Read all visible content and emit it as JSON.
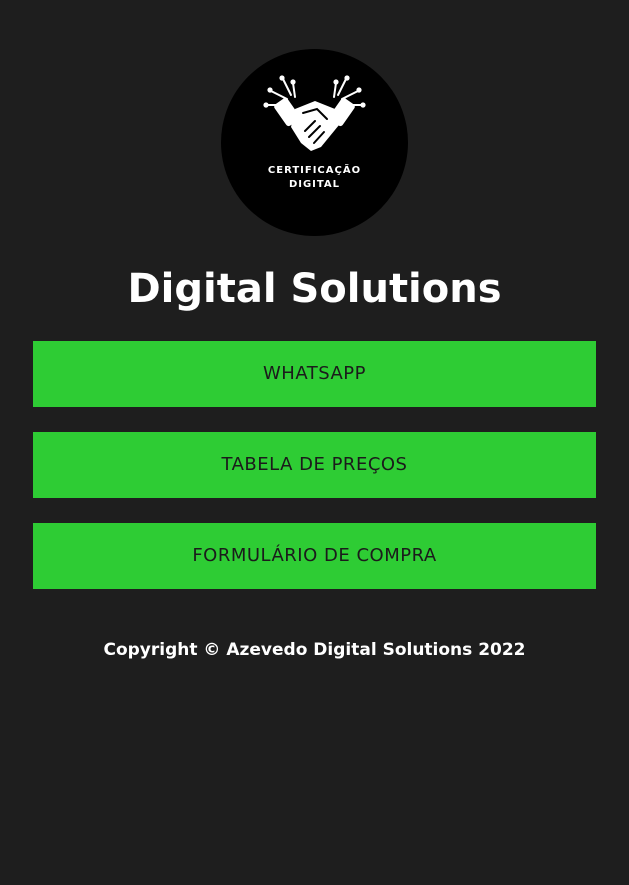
{
  "logo": {
    "icon": "handshake-circuit-icon",
    "line1": "CERTIFICAÇÃO",
    "line2": "DIGITAL",
    "background_color": "#000000"
  },
  "header": {
    "title": "Digital Solutions"
  },
  "buttons": [
    {
      "label": "WHATSAPP"
    },
    {
      "label": "TABELA DE PREÇOS"
    },
    {
      "label": "FORMULÁRIO DE COMPRA"
    }
  ],
  "footer": {
    "copyright": "Copyright © Azevedo Digital Solutions 2022"
  },
  "colors": {
    "page_background": "#1e1e1e",
    "button_background": "#2ecc34",
    "button_text": "#1b1b1b",
    "text": "#ffffff"
  }
}
